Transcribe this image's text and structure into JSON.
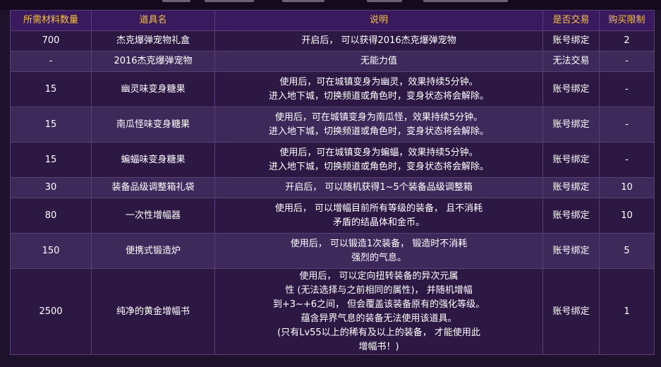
{
  "header": {
    "columns": [
      "所需材料数量",
      "道具名",
      "说明",
      "是否交易",
      "购买限制"
    ]
  },
  "rows": [
    {
      "cost": "700",
      "name": "杰克爆弹宠物礼盒",
      "desc": [
        "开启后， 可以获得2016杰克爆弹宠物"
      ],
      "trade": "账号绑定",
      "limit": "2"
    },
    {
      "cost": "-",
      "name": "2016杰克爆弹宠物",
      "desc": [
        "无能力值"
      ],
      "trade": "无法交易",
      "limit": "-"
    },
    {
      "cost": "15",
      "name": "幽灵味变身糖果",
      "desc": [
        "使用后，可在城镇变身为幽灵，效果持续5分钟。",
        "进入地下城，切换频道或角色时，变身状态将会解除。"
      ],
      "trade": "账号绑定",
      "limit": "-"
    },
    {
      "cost": "15",
      "name": "南瓜怪味变身糖果",
      "desc": [
        "使用后，可在城镇变身为南瓜怪，效果持续5分钟。",
        "进入地下城，切换频道或角色时，变身状态将会解除。"
      ],
      "trade": "账号绑定",
      "limit": "-"
    },
    {
      "cost": "15",
      "name": "蝙蝠味变身糖果",
      "desc": [
        "使用后，可在城镇变身为蝙蝠，效果持续5分钟。",
        "进入地下城，切换频道或角色时，变身状态将会解除。"
      ],
      "trade": "账号绑定",
      "limit": "-"
    },
    {
      "cost": "30",
      "name": "装备品级调整箱礼袋",
      "desc": [
        "开启后， 可以随机获得1~5个装备品级调整箱"
      ],
      "trade": "账号绑定",
      "limit": "10"
    },
    {
      "cost": "80",
      "name": "一次性增幅器",
      "desc": [
        "使用后， 可以增幅目前所有等级的装备， 且不消耗",
        "矛盾的结晶体和金币。"
      ],
      "trade": "账号绑定",
      "limit": "10"
    },
    {
      "cost": "150",
      "name": "便携式锻造炉",
      "desc": [
        "使用后， 可以锻造1次装备， 锻造时不消耗",
        "强烈的气息。"
      ],
      "trade": "账号绑定",
      "limit": "5"
    },
    {
      "cost": "2500",
      "name": "纯净的黄金增幅书",
      "desc": [
        "使用后， 可以定向扭转装备的异次元属",
        "性 (无法选择与之前相同的属性)， 并随机增幅",
        "到+3~+6之间， 但会覆盖该装备原有的强化等级。",
        "蕴含异界气息的装备无法使用该道具。",
        "(只有Lv55以上的稀有及以上的装备， 才能使用此",
        "增幅书！)"
      ],
      "trade": "账号绑定",
      "limit": "1"
    }
  ]
}
